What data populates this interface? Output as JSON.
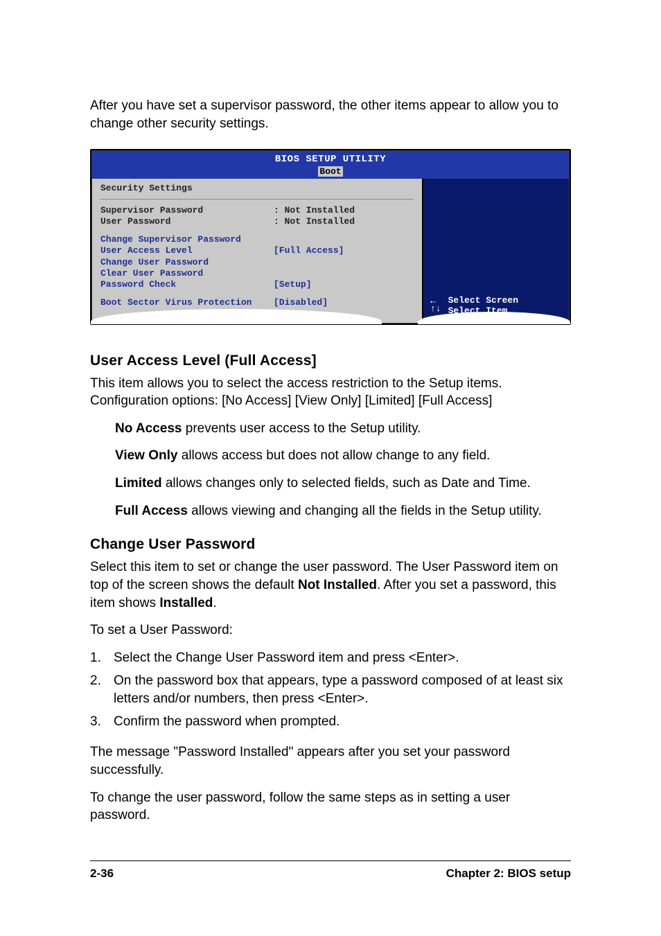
{
  "intro": "After you have set a supervisor password, the other items appear to allow you to change other security settings.",
  "bios": {
    "title": "BIOS SETUP UTILITY",
    "tab": "Boot",
    "section": "Security Settings",
    "supervisor_label": "Supervisor Password",
    "supervisor_status": ": Not Installed",
    "user_label": "User Password",
    "user_status": ": Not Installed",
    "change_supervisor": "Change Supervisor Password",
    "user_access_label": "User Access Level",
    "user_access_value": "[Full Access]",
    "change_user": "Change User Password",
    "clear_user": "Clear User Password",
    "pw_check_label": "Password Check",
    "pw_check_value": "[Setup]",
    "bootsec_label": "Boot Sector Virus Protection",
    "bootsec_value": "[Disabled]",
    "nav_select_screen": "Select Screen",
    "nav_select_item": "Select Item",
    "arrow_lr": "←",
    "arrow_ud": "↑↓"
  },
  "h_user_access": "User Access Level (Full Access]",
  "user_access_intro": "This item allows you to select the access restriction to the Setup items. Configuration options: [No Access] [View Only] [Limited] [Full Access]",
  "opts": {
    "no_access_b": "No Access",
    "no_access_t": " prevents user access to the Setup utility.",
    "view_only_b": "View Only",
    "view_only_t": " allows access but does not allow change to any field.",
    "limited_b": "Limited",
    "limited_t": " allows changes only to selected fields, such as Date and Time.",
    "full_access_b": "Full Access",
    "full_access_t": " allows viewing and changing all the fields in the Setup utility."
  },
  "h_change_user": "Change User Password",
  "change_user_p1a": "Select this item to set or change the user password. The User Password item on top of the screen shows the default ",
  "change_user_p1b": "Not Installed",
  "change_user_p1c": ". After you set a password, this item shows ",
  "change_user_p1d": "Installed",
  "change_user_p1e": ".",
  "to_set": "To set a User Password:",
  "steps": {
    "n1": "1.",
    "t1": "Select the Change User Password item and press <Enter>.",
    "n2": "2.",
    "t2": "On the password box that appears, type a password composed of at least six letters and/or numbers, then press <Enter>.",
    "n3": "3.",
    "t3": "Confirm the password when prompted."
  },
  "after_msg": "The message \"Password Installed\" appears after you set your password successfully.",
  "to_change": "To change the user password, follow the same steps as in setting a user password.",
  "footer": {
    "page": "2-36",
    "chapter": "Chapter 2: BIOS setup"
  }
}
